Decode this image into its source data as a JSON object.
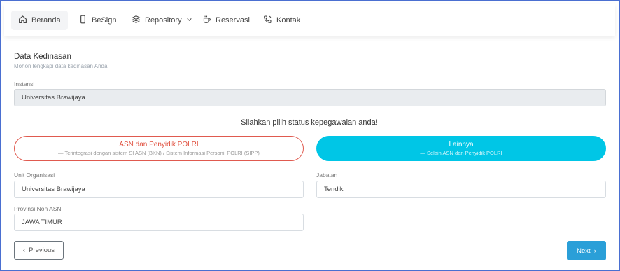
{
  "nav": {
    "items": [
      {
        "label": "Beranda",
        "icon": "home-icon"
      },
      {
        "label": "BeSign",
        "icon": "phone-icon"
      },
      {
        "label": "Repository",
        "icon": "layers-icon"
      },
      {
        "label": "Reservasi",
        "icon": "coffee-cup-icon"
      },
      {
        "label": "Kontak",
        "icon": "phone-call-icon"
      }
    ]
  },
  "section": {
    "title": "Data Kedinasan",
    "subtitle": "Mohon lengkapi data kedinasan Anda."
  },
  "form": {
    "instansi": {
      "label": "Instansi",
      "value": "Universitas Brawijaya"
    },
    "prompt": "Silahkan pilih status kepegawaian anda!",
    "choices": {
      "asn": {
        "title": "ASN dan Penyidik POLRI",
        "subtitle": "— Terintegrasi dengan sistem SI ASN (BKN) / Sistem Informasi Personil POLRI (SIPP)"
      },
      "other": {
        "title": "Lainnya",
        "subtitle": "— Selain ASN dan Penyidik POLRI"
      }
    },
    "unit": {
      "label": "Unit Organisasi",
      "value": "Universitas Brawijaya"
    },
    "jabatan": {
      "label": "Jabatan",
      "value": "Tendik"
    },
    "provinsi": {
      "label": "Provinsi Non ASN",
      "value": "JAWA TIMUR"
    }
  },
  "buttons": {
    "previous": "Previous",
    "next": "Next",
    "previous_glyph": "‹",
    "next_glyph": "›"
  },
  "colors": {
    "accent": "#00c6e6",
    "danger": "#e0503f",
    "primary_button": "#2a9fd8"
  }
}
